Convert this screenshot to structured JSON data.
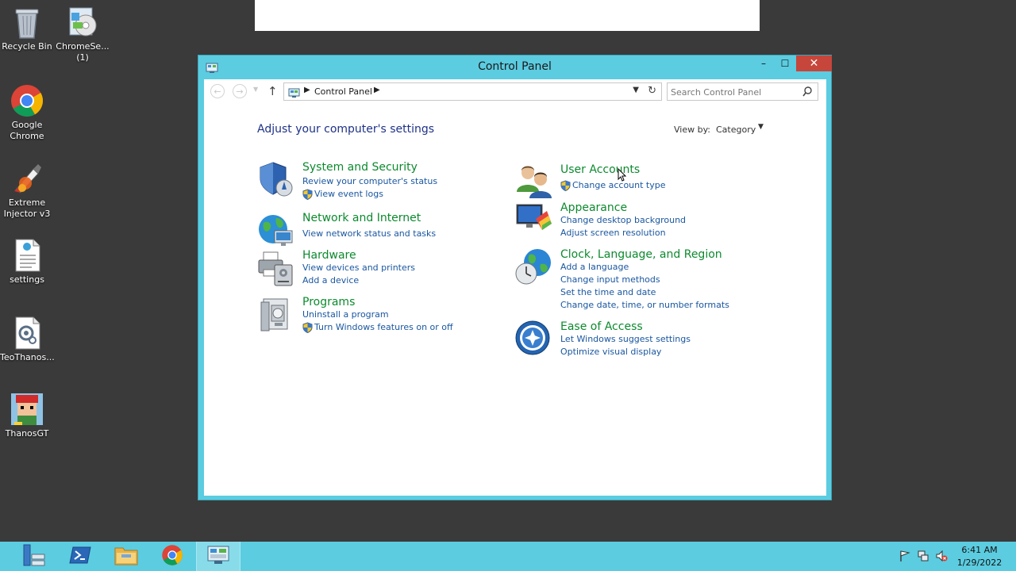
{
  "desktop": {
    "icons": [
      {
        "label": "Recycle Bin",
        "icon": "recycle-bin-icon"
      },
      {
        "label": "ChromeSe...\n(1)",
        "icon": "installer-icon"
      },
      {
        "label": "Google\nChrome",
        "icon": "chrome-icon"
      },
      {
        "label": "Extreme\nInjector v3",
        "icon": "injector-icon"
      },
      {
        "label": "settings",
        "icon": "text-file-icon"
      },
      {
        "label": "TeoThanos...",
        "icon": "config-file-icon"
      },
      {
        "label": "ThanosGT",
        "icon": "game-icon"
      }
    ]
  },
  "window": {
    "title": "Control Panel",
    "minimize": "–",
    "maximize": "☐",
    "close": "✕"
  },
  "nav": {
    "breadcrumb": "Control Panel",
    "search_placeholder": "Search Control Panel"
  },
  "main": {
    "heading": "Adjust your computer's settings",
    "view_by_label": "View by:",
    "view_by_value": "Category"
  },
  "categories": {
    "system_security": {
      "title": "System and Security",
      "links": [
        "Review your computer's status",
        "View event logs"
      ]
    },
    "network": {
      "title": "Network and Internet",
      "links": [
        "View network status and tasks"
      ]
    },
    "hardware": {
      "title": "Hardware",
      "links": [
        "View devices and printers",
        "Add a device"
      ]
    },
    "programs": {
      "title": "Programs",
      "links": [
        "Uninstall a program",
        "Turn Windows features on or off"
      ]
    },
    "user_accounts": {
      "title": "User Accounts",
      "links": [
        "Change account type"
      ]
    },
    "appearance": {
      "title": "Appearance",
      "links": [
        "Change desktop background",
        "Adjust screen resolution"
      ]
    },
    "clock": {
      "title": "Clock, Language, and Region",
      "links": [
        "Add a language",
        "Change input methods",
        "Set the time and date",
        "Change date, time, or number formats"
      ]
    },
    "ease": {
      "title": "Ease of Access",
      "links": [
        "Let Windows suggest settings",
        "Optimize visual display"
      ]
    }
  },
  "taskbar": {
    "time": "6:41 AM",
    "date": "1/29/2022"
  },
  "colors": {
    "accent": "#5ccce0",
    "category_title": "#0c8a2e",
    "link": "#1a57a0",
    "close_button": "#c7463b"
  }
}
